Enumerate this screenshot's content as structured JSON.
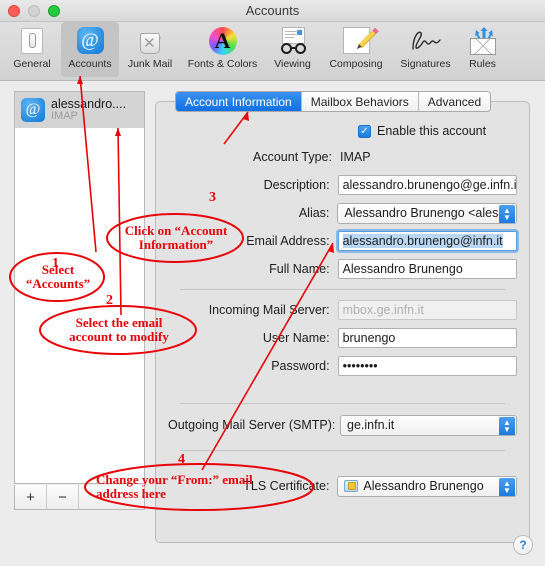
{
  "window": {
    "title": "Accounts",
    "traffic_lights": [
      "close-button",
      "minimize-button",
      "zoom-button"
    ]
  },
  "toolbar": {
    "items": [
      {
        "label": "General",
        "icon": "general-icon",
        "selected": false
      },
      {
        "label": "Accounts",
        "icon": "accounts-at-icon",
        "selected": true
      },
      {
        "label": "Junk Mail",
        "icon": "junk-mail-icon",
        "selected": false
      },
      {
        "label": "Fonts & Colors",
        "icon": "fonts-colors-icon",
        "selected": false
      },
      {
        "label": "Viewing",
        "icon": "viewing-glasses-icon",
        "selected": false
      },
      {
        "label": "Composing",
        "icon": "composing-pencil-icon",
        "selected": false
      },
      {
        "label": "Signatures",
        "icon": "signatures-icon",
        "selected": false
      },
      {
        "label": "Rules",
        "icon": "rules-envelope-icon",
        "selected": false
      }
    ]
  },
  "sidebar": {
    "accounts": [
      {
        "name": "alessandro....",
        "type": "IMAP",
        "selected": true,
        "icon": "account-at-icon"
      }
    ],
    "add_label": "+",
    "remove_label": "−"
  },
  "panel": {
    "tabs": [
      {
        "label": "Account Information",
        "active": true
      },
      {
        "label": "Mailbox Behaviors",
        "active": false
      },
      {
        "label": "Advanced",
        "active": false
      }
    ],
    "enable_checkbox": {
      "label": "Enable this account",
      "checked": true,
      "check_glyph": "✓"
    },
    "fields": {
      "account_type_label": "Account Type:",
      "account_type_value": "IMAP",
      "description_label": "Description:",
      "description_value": "alessandro.brunengo@ge.infn.it",
      "alias_label": "Alias:",
      "alias_value": "Alessandro Brunengo <alessa",
      "email_label": "Email Address:",
      "email_value": "alessandro.brunengo@infn.it",
      "fullname_label": "Full Name:",
      "fullname_value": "Alessandro Brunengo",
      "incoming_label": "Incoming Mail Server:",
      "incoming_value": "mbox.ge.infn.it",
      "username_label": "User Name:",
      "username_value": "brunengo",
      "password_label": "Password:",
      "password_value": "••••••••",
      "smtp_label": "Outgoing Mail Server (SMTP):",
      "smtp_value": "ge.infn.it",
      "tls_label": "TLS Certificate:",
      "tls_value": "Alessandro Brunengo"
    },
    "help_label": "?"
  },
  "annotations": [
    {
      "number": "1",
      "text": "Select\n“Accounts”"
    },
    {
      "number": "2",
      "text": "Select the email\naccount to modify"
    },
    {
      "number": "3",
      "text": "Click on “Account\nInformation”"
    },
    {
      "number": "4",
      "text": "Change your “From:” email\naddress here"
    }
  ],
  "annotation_text": {
    "a1_line1": "Select",
    "a1_line2": "“Accounts”",
    "a2_line1": "Select the email",
    "a2_line2": "account to modify",
    "a3_line1": "Click on “Account",
    "a3_line2": "Information”",
    "a4_line1": "Change your “From:” email",
    "a4_line2": "address here",
    "n1": "1",
    "n2": "2",
    "n3": "3",
    "n4": "4"
  },
  "colors": {
    "accent_blue": "#1170e4",
    "annotation_red": "#e8050a",
    "window_chrome": "#ececec"
  }
}
